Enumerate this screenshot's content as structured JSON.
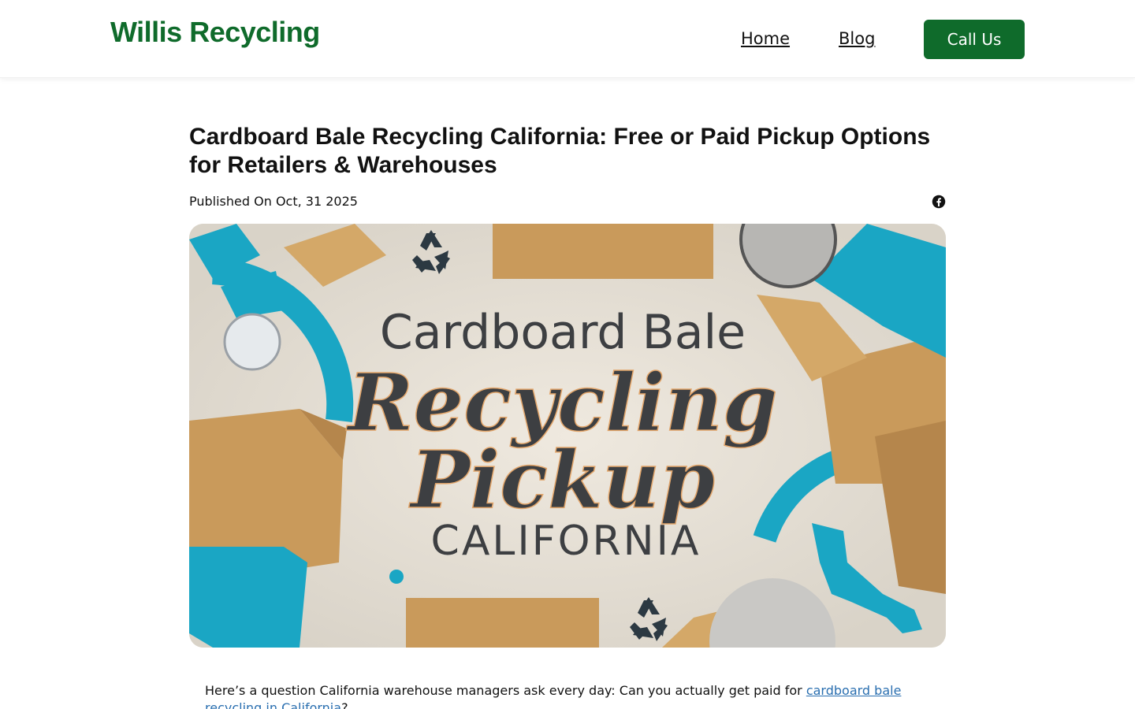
{
  "header": {
    "logo": "Willis Recycling",
    "nav": [
      {
        "label": "Home"
      },
      {
        "label": "Blog"
      }
    ],
    "cta_label": "Call Us"
  },
  "article": {
    "title": "Cardboard Bale Recycling California: Free or Paid Pickup Options for Retailers & Warehouses",
    "published": "Published On Oct, 31 2025",
    "share_icon": "facebook-icon",
    "hero": {
      "line1": "Cardboard Bale",
      "line2": "Recycling",
      "line3": "Pickup",
      "line4": "CALIFORNIA",
      "accent_teal": "#1aa6c4",
      "accent_cardboard": "#c99a5b"
    },
    "intro_text": "Here’s a question California warehouse managers ask every day: Can you actually get paid for ",
    "intro_link": "cardboard bale recycling in California",
    "intro_end": "?"
  }
}
